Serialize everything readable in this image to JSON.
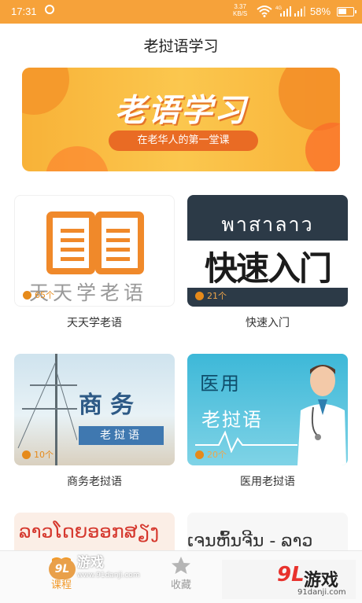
{
  "status_bar": {
    "time": "17:31",
    "net_speed": "3.37",
    "net_unit": "KB/S",
    "signal_badge": "4G",
    "battery": "58%",
    "battery_level": 0.58
  },
  "page_title": "老挝语学习",
  "banner": {
    "headline": "老语学习",
    "tagline": "在老华人的第一堂课",
    "colors": {
      "background": "#f8b238",
      "accent": "#e96b24"
    }
  },
  "courses": [
    {
      "name": "天天学老语",
      "thumb_caption": "天天学老语",
      "count": "65个"
    },
    {
      "name": "快速入门",
      "thumb_caption_lao": "พาสาลาว",
      "thumb_caption": "快速入门",
      "count": "21个"
    },
    {
      "name": "商务老挝语",
      "thumb_caption": "商务",
      "thumb_tag": "老挝语",
      "count": "10个"
    },
    {
      "name": "医用老挝语",
      "thumb_caption": "医用",
      "thumb_tag": "老挝语",
      "count": "20个"
    }
  ],
  "partial_cards": [
    {
      "text": "ລາວໂດຍອອກສຽງ"
    },
    {
      "text": "ເຈນຫົ້ນຈີນ - ລາວ"
    }
  ],
  "tab_bar": {
    "tabs": [
      {
        "label": "课程",
        "icon": "book-icon",
        "active": true
      },
      {
        "label": "收藏",
        "icon": "star-icon",
        "active": false
      }
    ],
    "active_color": "#f29a2a"
  },
  "watermarks": {
    "left_badge": "9L",
    "left_text": "游戏",
    "left_url": "www.91danji.com",
    "right_badge": "9L",
    "right_text": "游戏",
    "right_url": "91danji.com"
  }
}
